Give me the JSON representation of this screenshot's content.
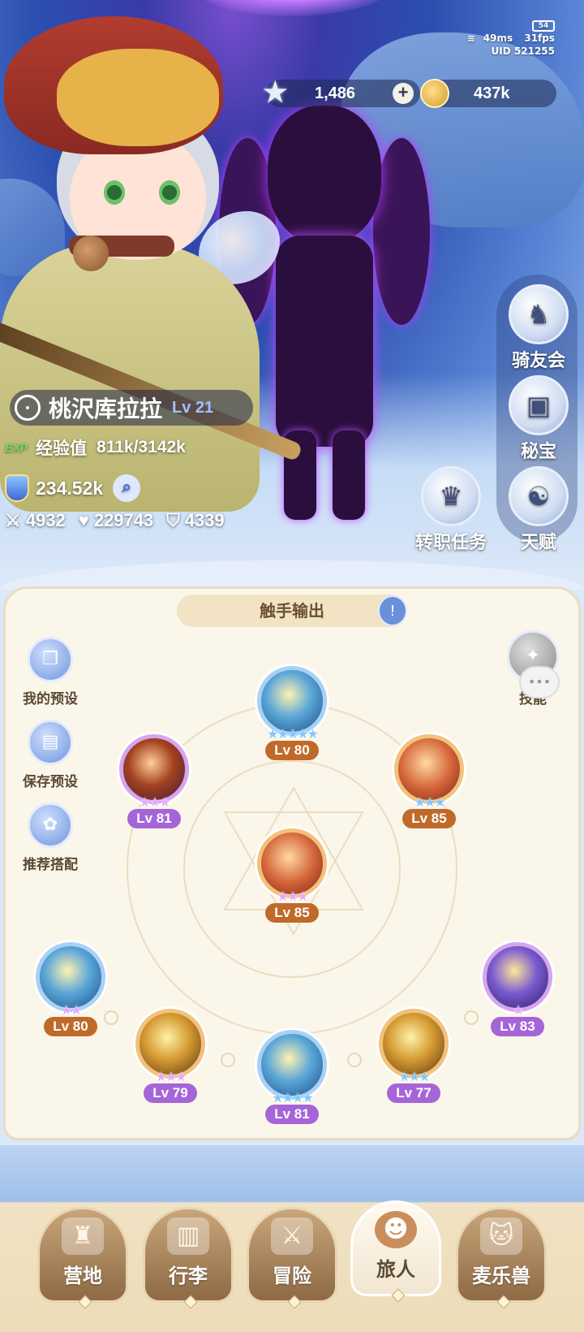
{
  "status": {
    "battery": "54",
    "ping": "49ms",
    "fps": "31fps",
    "uid": "UID 521255"
  },
  "currency": {
    "stars": "1,486",
    "coins": "437k",
    "plus": "+"
  },
  "character": {
    "name": "桃沢库拉拉",
    "level": "Lv 21",
    "exp_tag": "EXP",
    "exp_label": "经验值",
    "exp_value": "811k/3142k",
    "power": "234.52k",
    "attack": "4932",
    "hp": "229743",
    "defense": "4339"
  },
  "side_menu": [
    {
      "label": "骑友会",
      "icon": "horse-icon"
    },
    {
      "label": "秘宝",
      "icon": "treasure-chest-icon"
    },
    {
      "label": "天赋",
      "icon": "brain-icon"
    }
  ],
  "job_quest": {
    "label": "转职任务",
    "icon": "crown-icon"
  },
  "skill_panel": {
    "tab_title": "触手输出",
    "left_buttons": [
      "我的预设",
      "保存预设",
      "推荐搭配"
    ],
    "top_right_label": "技能",
    "nodes": [
      {
        "lv": "Lv 80",
        "stars": "★★★★★",
        "theme": "blue"
      },
      {
        "lv": "Lv 81",
        "stars": "★★★",
        "theme": "purple"
      },
      {
        "lv": "Lv 85",
        "stars": "★★★",
        "theme": "blue"
      },
      {
        "lv": "Lv 85",
        "stars": "★★★",
        "theme": "purple"
      },
      {
        "lv": "Lv 80",
        "stars": "★★",
        "theme": "orange"
      },
      {
        "lv": "Lv 83",
        "stars": "★",
        "theme": "purple"
      },
      {
        "lv": "Lv 79",
        "stars": "★★★",
        "theme": "purple"
      },
      {
        "lv": "Lv 81",
        "stars": "★★★★",
        "theme": "blue"
      },
      {
        "lv": "Lv 77",
        "stars": "★★★",
        "theme": "blue"
      }
    ]
  },
  "bottom_nav": [
    {
      "label": "营地",
      "icon": "castle-icon",
      "active": false
    },
    {
      "label": "行李",
      "icon": "backpack-icon",
      "active": false
    },
    {
      "label": "冒险",
      "icon": "crossed-swords-icon",
      "active": false
    },
    {
      "label": "旅人",
      "icon": "traveler-avatar-icon",
      "active": true
    },
    {
      "label": "麦乐兽",
      "icon": "cat-pet-icon",
      "active": false
    }
  ]
}
